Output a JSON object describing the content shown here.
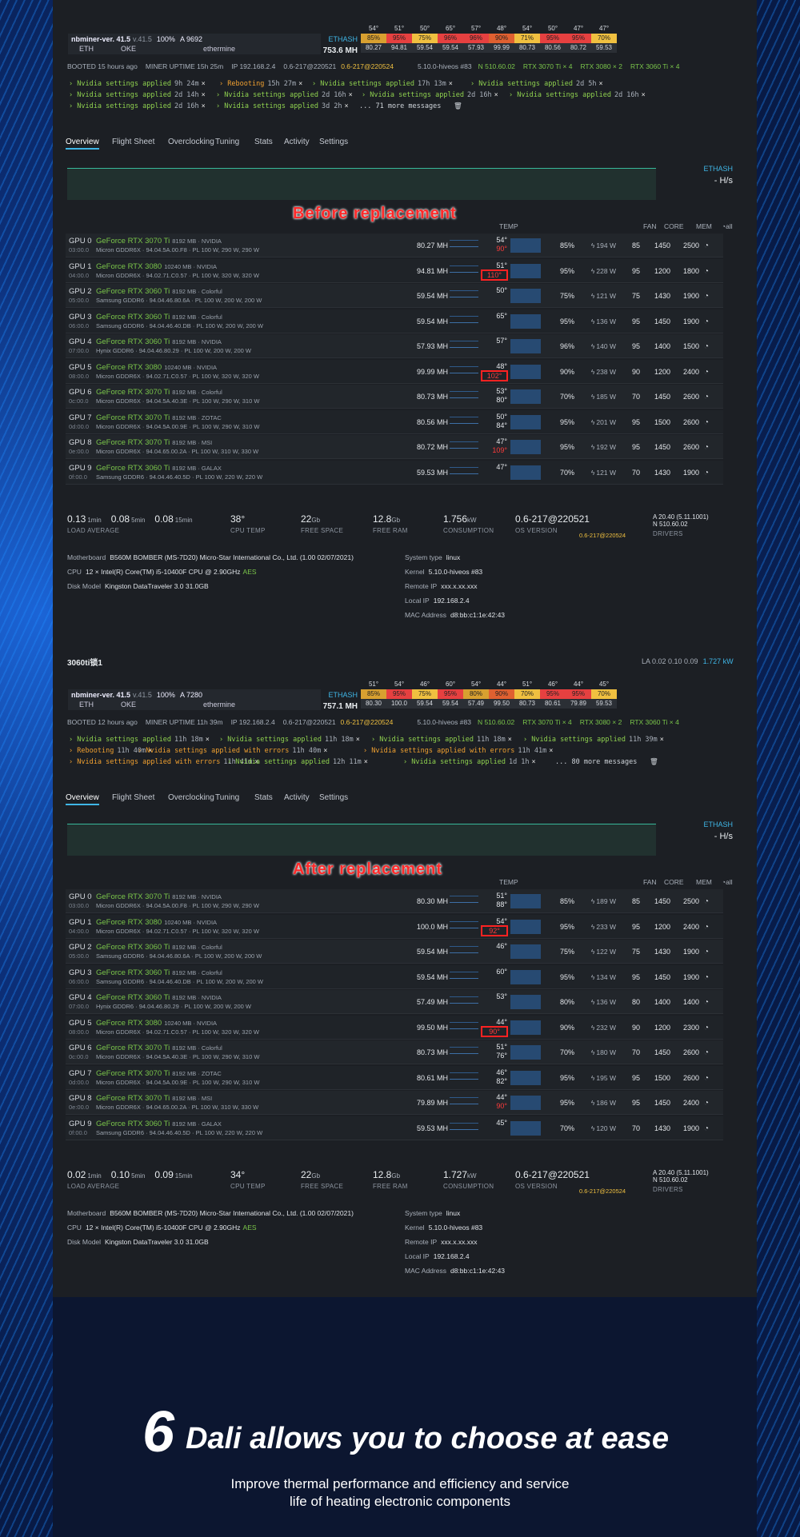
{
  "before": {
    "miner_name": "nbminer-ver. 41.5",
    "miner_version": "v.41.5",
    "miner_pct": "100%",
    "miner_a": "A 9692",
    "coin": "ETH",
    "pool_short": "OKE",
    "pool": "ethermine",
    "algo": "ETHASH",
    "hashrate": "753.6 MH",
    "temp_top": [
      "54°",
      "51°",
      "50°",
      "65°",
      "57°",
      "48°",
      "54°",
      "50°",
      "47°",
      "47°"
    ],
    "fan_row": [
      "85%",
      "95%",
      "75%",
      "96%",
      "96%",
      "90%",
      "71%",
      "95%",
      "95%",
      "70%"
    ],
    "hash_row": [
      "80.27",
      "94.81",
      "59.54",
      "59.54",
      "57.93",
      "99.99",
      "80.73",
      "80.56",
      "80.72",
      "59.53"
    ],
    "booted": "BOOTED 15 hours ago",
    "uptime": "MINER UPTIME 15h 25m",
    "ip": "IP 192.168.2.4",
    "os": "0.6-217@220521",
    "os_new": "0.6-217@220524",
    "kernel": "5.10.0-hiveos #83",
    "driver": "N 510.60.02",
    "gpu_summary": [
      "RTX 3070 Ti × 4",
      "RTX 3080 × 2",
      "RTX 3060 Ti × 4"
    ],
    "messages": [
      {
        "text": "Nvidia settings applied",
        "time": "9h 24m"
      },
      {
        "text": "Rebooting",
        "time": "15h 27m"
      },
      {
        "text": "Nvidia settings applied",
        "time": "17h 13m"
      },
      {
        "text": "Nvidia settings applied",
        "time": "2d 5h"
      },
      {
        "text": "Nvidia settings applied",
        "time": "2d 14h"
      },
      {
        "text": "Nvidia settings applied",
        "time": "2d 16h"
      },
      {
        "text": "Nvidia settings applied",
        "time": "2d 16h"
      },
      {
        "text": "Nvidia settings applied",
        "time": "2d 16h"
      },
      {
        "text": "Nvidia settings applied",
        "time": "2d 16h"
      },
      {
        "text": "Nvidia settings applied",
        "time": "3d 2h"
      }
    ],
    "more": "... 71 more messages",
    "tabs": [
      "Overview",
      "Flight Sheet",
      "Overclocking",
      "Tuning",
      "Stats",
      "Activity",
      "Settings"
    ],
    "banner": "Before replacement",
    "hs": "- H/s",
    "gpus": [
      {
        "id": "GPU 0",
        "bus": "03:00.0",
        "name": "GeForce RTX 3070 Ti",
        "spec": "8192 MB · NVIDIA",
        "mem": "Micron GDDR6X · 94.04.5A.00.F8 · PL 100 W, 290 W, 290 W",
        "hash": "80.27 MH",
        "t1": "54°",
        "t2": "90°",
        "t2c": "hot",
        "fanp": "85%",
        "watt": "194 W",
        "fan": "85",
        "core": "1450",
        "memc": "2500"
      },
      {
        "id": "GPU 1",
        "bus": "04:00.0",
        "name": "GeForce RTX 3080",
        "spec": "10240 MB · NVIDIA",
        "mem": "Micron GDDR6X · 94.02.71.C0.57 · PL 100 W, 320 W, 320 W",
        "hash": "94.81 MH",
        "t1": "51°",
        "t2": "110°",
        "t2c": "box",
        "fanp": "95%",
        "watt": "228 W",
        "fan": "95",
        "core": "1200",
        "memc": "1800"
      },
      {
        "id": "GPU 2",
        "bus": "05:00.0",
        "name": "GeForce RTX 3060 Ti",
        "spec": "8192 MB · Colorful",
        "mem": "Samsung GDDR6 · 94.04.46.80.6A · PL 100 W, 200 W, 200 W",
        "hash": "59.54 MH",
        "t1": "50°",
        "t2": "",
        "t2c": "",
        "fanp": "75%",
        "watt": "121 W",
        "fan": "75",
        "core": "1430",
        "memc": "1900"
      },
      {
        "id": "GPU 3",
        "bus": "06:00.0",
        "name": "GeForce RTX 3060 Ti",
        "spec": "8192 MB · Colorful",
        "mem": "Samsung GDDR6 · 94.04.46.40.DB · PL 100 W, 200 W, 200 W",
        "hash": "59.54 MH",
        "t1": "65°",
        "t2": "",
        "t2c": "",
        "fanp": "95%",
        "watt": "136 W",
        "fan": "95",
        "core": "1450",
        "memc": "1900"
      },
      {
        "id": "GPU 4",
        "bus": "07:00.0",
        "name": "GeForce RTX 3060 Ti",
        "spec": "8192 MB · NVIDIA",
        "mem": "Hynix GDDR6 · 94.04.46.80.29 · PL 100 W, 200 W, 200 W",
        "hash": "57.93 MH",
        "t1": "57°",
        "t2": "",
        "t2c": "",
        "fanp": "96%",
        "watt": "140 W",
        "fan": "95",
        "core": "1400",
        "memc": "1500"
      },
      {
        "id": "GPU 5",
        "bus": "08:00.0",
        "name": "GeForce RTX 3080",
        "spec": "10240 MB · NVIDIA",
        "mem": "Micron GDDR6X · 94.02.71.C0.57 · PL 100 W, 320 W, 320 W",
        "hash": "99.99 MH",
        "t1": "48°",
        "t2": "102°",
        "t2c": "box",
        "fanp": "90%",
        "watt": "238 W",
        "fan": "90",
        "core": "1200",
        "memc": "2400"
      },
      {
        "id": "GPU 6",
        "bus": "0c:00.0",
        "name": "GeForce RTX 3070 Ti",
        "spec": "8192 MB · Colorful",
        "mem": "Micron GDDR6X · 94.04.5A.40.3E · PL 100 W, 290 W, 310 W",
        "hash": "80.73 MH",
        "t1": "53°",
        "t2": "80°",
        "t2c": "",
        "fanp": "70%",
        "watt": "185 W",
        "fan": "70",
        "core": "1450",
        "memc": "2600"
      },
      {
        "id": "GPU 7",
        "bus": "0d:00.0",
        "name": "GeForce RTX 3070 Ti",
        "spec": "8192 MB · ZOTAC",
        "mem": "Micron GDDR6X · 94.04.5A.00.9E · PL 100 W, 290 W, 310 W",
        "hash": "80.56 MH",
        "t1": "50°",
        "t2": "84°",
        "t2c": "",
        "fanp": "95%",
        "watt": "201 W",
        "fan": "95",
        "core": "1500",
        "memc": "2600"
      },
      {
        "id": "GPU 8",
        "bus": "0e:00.0",
        "name": "GeForce RTX 3070 Ti",
        "spec": "8192 MB · MSI",
        "mem": "Micron GDDR6X · 94.04.65.00.2A · PL 100 W, 310 W, 330 W",
        "hash": "80.72 MH",
        "t1": "47°",
        "t2": "109°",
        "t2c": "hot",
        "fanp": "95%",
        "watt": "192 W",
        "fan": "95",
        "core": "1450",
        "memc": "2600"
      },
      {
        "id": "GPU 9",
        "bus": "0f:00.0",
        "name": "GeForce RTX 3060 Ti",
        "spec": "8192 MB · GALAX",
        "mem": "Samsung GDDR6 · 94.04.46.40.5D · PL 100 W, 220 W, 220 W",
        "hash": "59.53 MH",
        "t1": "47°",
        "t2": "",
        "t2c": "",
        "fanp": "70%",
        "watt": "121 W",
        "fan": "70",
        "core": "1430",
        "memc": "1900"
      }
    ],
    "la1": "0.13",
    "la5": "0.08",
    "la15": "0.08",
    "cpu_temp": "38°",
    "free_space": "22",
    "free_ram": "12.8",
    "consumption": "1.756",
    "os_version": "0.6-217@220521",
    "os_version_new": "0.6-217@220524",
    "drivers_a": "A 20.40 (5.11.1001)",
    "drivers_n": "N 510.60.02",
    "mb": "B560M BOMBER (MS-7D20) Micro-Star International Co., Ltd. (1.00 02/07/2021)",
    "cpu": "12 × Intel(R) Core(TM) i5-10400F CPU @ 2.90GHz",
    "aes": "AES",
    "disk": "Kingston DataTraveler 3.0 31.0GB",
    "systype": "linux",
    "kernel2": "5.10.0-hiveos #83",
    "remote_ip": "xxx.x.xx.xxx",
    "local_ip": "192.168.2.4",
    "mac": "d8:bb:c1:1e:42:43"
  },
  "after": {
    "worker": "3060ti锁1",
    "la_head": "LA 0.02 0.10 0.09",
    "la_kw": "1.727 kW",
    "miner_name": "nbminer-ver. 41.5",
    "miner_version": "v.41.5",
    "miner_pct": "100%",
    "miner_a": "A 7280",
    "coin": "ETH",
    "pool_short": "OKE",
    "pool": "ethermine",
    "algo": "ETHASH",
    "hashrate": "757.1 MH",
    "temp_top": [
      "51°",
      "54°",
      "46°",
      "60°",
      "54°",
      "44°",
      "51°",
      "46°",
      "44°",
      "45°"
    ],
    "fan_row": [
      "85%",
      "95%",
      "75%",
      "95%",
      "80%",
      "90%",
      "70%",
      "95%",
      "95%",
      "70%"
    ],
    "hash_row": [
      "80.30",
      "100.0",
      "59.54",
      "59.54",
      "57.49",
      "99.50",
      "80.73",
      "80.61",
      "79.89",
      "59.53"
    ],
    "booted": "BOOTED 12 hours ago",
    "uptime": "MINER UPTIME 11h 39m",
    "ip": "IP 192.168.2.4",
    "os": "0.6-217@220521",
    "os_new": "0.6-217@220524",
    "kernel": "5.10.0-hiveos #83",
    "driver": "N 510.60.02",
    "gpu_summary": [
      "RTX 3070 Ti × 4",
      "RTX 3080 × 2",
      "RTX 3060 Ti × 4"
    ],
    "messages": [
      {
        "text": "Nvidia settings applied",
        "time": "11h 18m"
      },
      {
        "text": "Nvidia settings applied",
        "time": "11h 18m"
      },
      {
        "text": "Nvidia settings applied",
        "time": "11h 18m"
      },
      {
        "text": "Nvidia settings applied",
        "time": "11h 39m"
      },
      {
        "text": "Rebooting",
        "time": "11h 40m"
      },
      {
        "text": "Nvidia settings applied with errors",
        "time": "11h 40m"
      },
      {
        "text": "Nvidia settings applied with errors",
        "time": "11h 41m"
      },
      {
        "text": "Nvidia settings applied with errors",
        "time": "11h 41m"
      },
      {
        "text": "Nvidia settings applied",
        "time": "12h 11m"
      },
      {
        "text": "Nvidia settings applied",
        "time": "1d 1h"
      }
    ],
    "more": "... 80 more messages",
    "tabs": [
      "Overview",
      "Flight Sheet",
      "Overclocking",
      "Tuning",
      "Stats",
      "Activity",
      "Settings"
    ],
    "banner": "After replacement",
    "hs": "- H/s",
    "gpus": [
      {
        "id": "GPU 0",
        "bus": "03:00.0",
        "name": "GeForce RTX 3070 Ti",
        "spec": "8192 MB · NVIDIA",
        "mem": "Micron GDDR6X · 94.04.5A.00.F8 · PL 100 W, 290 W, 290 W",
        "hash": "80.30 MH",
        "t1": "51°",
        "t2": "88°",
        "t2c": "",
        "fanp": "85%",
        "watt": "189 W",
        "fan": "85",
        "core": "1450",
        "memc": "2500"
      },
      {
        "id": "GPU 1",
        "bus": "04:00.0",
        "name": "GeForce RTX 3080",
        "spec": "10240 MB · NVIDIA",
        "mem": "Micron GDDR6X · 94.02.71.C0.57 · PL 100 W, 320 W, 320 W",
        "hash": "100.0 MH",
        "t1": "54°",
        "t2": "92°",
        "t2c": "box",
        "fanp": "95%",
        "watt": "233 W",
        "fan": "95",
        "core": "1200",
        "memc": "2400"
      },
      {
        "id": "GPU 2",
        "bus": "05:00.0",
        "name": "GeForce RTX 3060 Ti",
        "spec": "8192 MB · Colorful",
        "mem": "Samsung GDDR6 · 94.04.46.80.6A · PL 100 W, 200 W, 200 W",
        "hash": "59.54 MH",
        "t1": "46°",
        "t2": "",
        "t2c": "",
        "fanp": "75%",
        "watt": "122 W",
        "fan": "75",
        "core": "1430",
        "memc": "1900"
      },
      {
        "id": "GPU 3",
        "bus": "06:00.0",
        "name": "GeForce RTX 3060 Ti",
        "spec": "8192 MB · Colorful",
        "mem": "Samsung GDDR6 · 94.04.46.40.DB · PL 100 W, 200 W, 200 W",
        "hash": "59.54 MH",
        "t1": "60°",
        "t2": "",
        "t2c": "",
        "fanp": "95%",
        "watt": "134 W",
        "fan": "95",
        "core": "1450",
        "memc": "1900"
      },
      {
        "id": "GPU 4",
        "bus": "07:00.0",
        "name": "GeForce RTX 3060 Ti",
        "spec": "8192 MB · NVIDIA",
        "mem": "Hynix GDDR6 · 94.04.46.80.29 · PL 100 W, 200 W, 200 W",
        "hash": "57.49 MH",
        "t1": "53°",
        "t2": "",
        "t2c": "",
        "fanp": "80%",
        "watt": "136 W",
        "fan": "80",
        "core": "1400",
        "memc": "1400"
      },
      {
        "id": "GPU 5",
        "bus": "08:00.0",
        "name": "GeForce RTX 3080",
        "spec": "10240 MB · NVIDIA",
        "mem": "Micron GDDR6X · 94.02.71.C0.57 · PL 100 W, 320 W, 320 W",
        "hash": "99.50 MH",
        "t1": "44°",
        "t2": "90°",
        "t2c": "box",
        "fanp": "90%",
        "watt": "232 W",
        "fan": "90",
        "core": "1200",
        "memc": "2300"
      },
      {
        "id": "GPU 6",
        "bus": "0c:00.0",
        "name": "GeForce RTX 3070 Ti",
        "spec": "8192 MB · Colorful",
        "mem": "Micron GDDR6X · 94.04.5A.40.3E · PL 100 W, 290 W, 310 W",
        "hash": "80.73 MH",
        "t1": "51°",
        "t2": "76°",
        "t2c": "",
        "fanp": "70%",
        "watt": "180 W",
        "fan": "70",
        "core": "1450",
        "memc": "2600"
      },
      {
        "id": "GPU 7",
        "bus": "0d:00.0",
        "name": "GeForce RTX 3070 Ti",
        "spec": "8192 MB · ZOTAC",
        "mem": "Micron GDDR6X · 94.04.5A.00.9E · PL 100 W, 290 W, 310 W",
        "hash": "80.61 MH",
        "t1": "46°",
        "t2": "82°",
        "t2c": "",
        "fanp": "95%",
        "watt": "195 W",
        "fan": "95",
        "core": "1500",
        "memc": "2600"
      },
      {
        "id": "GPU 8",
        "bus": "0e:00.0",
        "name": "GeForce RTX 3070 Ti",
        "spec": "8192 MB · MSI",
        "mem": "Micron GDDR6X · 94.04.65.00.2A · PL 100 W, 310 W, 330 W",
        "hash": "79.89 MH",
        "t1": "44°",
        "t2": "90°",
        "t2c": "hot",
        "fanp": "95%",
        "watt": "186 W",
        "fan": "95",
        "core": "1450",
        "memc": "2400"
      },
      {
        "id": "GPU 9",
        "bus": "0f:00.0",
        "name": "GeForce RTX 3060 Ti",
        "spec": "8192 MB · GALAX",
        "mem": "Samsung GDDR6 · 94.04.46.40.5D · PL 100 W, 220 W, 220 W",
        "hash": "59.53 MH",
        "t1": "45°",
        "t2": "",
        "t2c": "",
        "fanp": "70%",
        "watt": "120 W",
        "fan": "70",
        "core": "1430",
        "memc": "1900"
      }
    ],
    "la1": "0.02",
    "la5": "0.10",
    "la15": "0.09",
    "cpu_temp": "34°",
    "free_space": "22",
    "free_ram": "12.8",
    "consumption": "1.727",
    "os_version": "0.6-217@220521",
    "os_version_new": "0.6-217@220524",
    "drivers_a": "A 20.40 (5.11.1001)",
    "drivers_n": "N 510.60.02",
    "mb": "B560M BOMBER (MS-7D20) Micro-Star International Co., Ltd. (1.00 02/07/2021)",
    "cpu": "12 × Intel(R) Core(TM) i5-10400F CPU @ 2.90GHz",
    "aes": "AES",
    "disk": "Kingston DataTraveler 3.0 31.0GB",
    "systype": "linux",
    "kernel2": "5.10.0-hiveos #83",
    "remote_ip": "xxx.x.xx.xxx",
    "local_ip": "192.168.2.4",
    "mac": "d8:bb:c1:1e:42:43"
  },
  "labels": {
    "temp": "TEMP",
    "fan": "FAN",
    "core": "CORE",
    "mem": "MEM",
    "all": "all",
    "load_average": "LOAD AVERAGE",
    "cpu_temp": "CPU TEMP",
    "free_space": "FREE SPACE",
    "free_ram": "FREE RAM",
    "consumption": "CONSUMPTION",
    "os_version": "OS VERSION",
    "drivers": "DRIVERS",
    "min1": "1min",
    "min5": "5min",
    "min15": "15min",
    "gb": "Gb",
    "kw": "kW",
    "motherboard": "Motherboard",
    "cpu": "CPU",
    "disk_model": "Disk Model",
    "system_type": "System type",
    "kernel": "Kernel",
    "remote_ip": "Remote IP",
    "local_ip": "Local IP",
    "mac": "MAC Address"
  },
  "promo": {
    "number": "6",
    "title": "Dali allows you to choose at ease",
    "sub1": "Improve thermal performance and efficiency and service",
    "sub2": "life of heating electronic components"
  },
  "colors": {
    "accent": "#3fb6e6",
    "ok": "#7ac54a",
    "hot": "#ff3b3b",
    "temp_hot_bg": "#e64040",
    "temp_warm_bg": "#f0c040"
  }
}
